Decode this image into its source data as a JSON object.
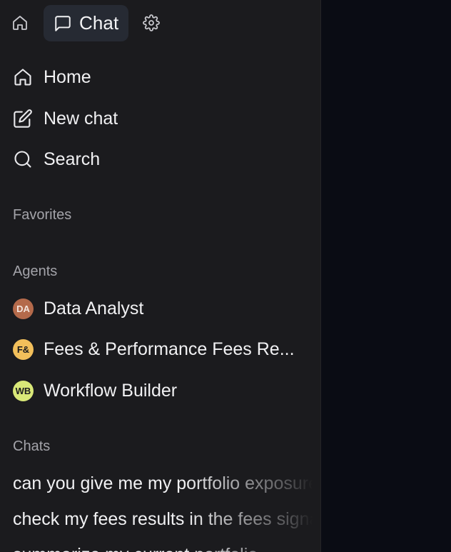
{
  "topbar": {
    "home_icon": "home-icon",
    "chat_tab_label": "Chat",
    "chat_icon": "message-square-icon",
    "settings_icon": "gear-icon"
  },
  "nav": {
    "items": [
      {
        "label": "Home",
        "icon": "home-icon"
      },
      {
        "label": "New chat",
        "icon": "edit-icon"
      },
      {
        "label": "Search",
        "icon": "search-icon"
      }
    ]
  },
  "sections": {
    "favorites": "Favorites",
    "agents": "Agents",
    "chats": "Chats"
  },
  "agents": [
    {
      "initials": "DA",
      "label": "Data Analyst",
      "color": "#b46a4b",
      "text_color": "#f3e4dc"
    },
    {
      "initials": "F&",
      "label": "Fees & Performance Fees Re...",
      "color": "#f2bf5b",
      "text_color": "#1b1b1e"
    },
    {
      "initials": "WB",
      "label": "Workflow Builder",
      "color": "#d9e878",
      "text_color": "#1b1b1e"
    }
  ],
  "chats": [
    {
      "label": "can you give me my portfolio exposure"
    },
    {
      "label": "check my fees results in the fees signal"
    },
    {
      "label": "summarize my current portfolio"
    }
  ],
  "colors": {
    "sidebar_bg": "#1b1b1e",
    "main_bg": "#0a0c14",
    "active_tab_bg": "#262a33"
  }
}
